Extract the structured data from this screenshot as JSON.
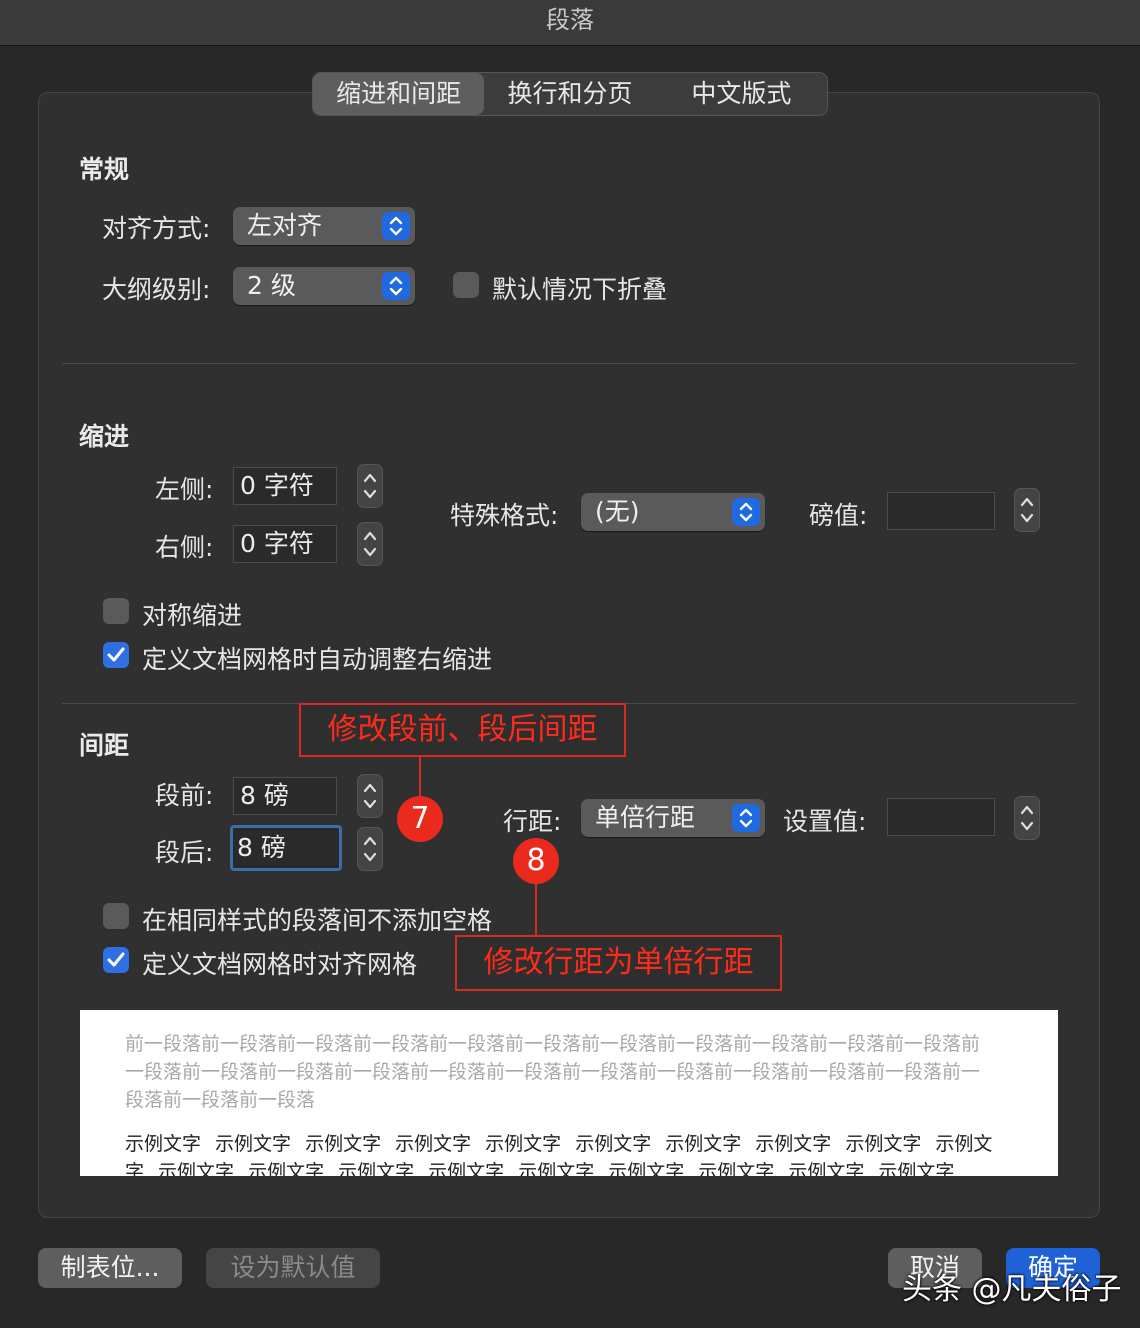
{
  "window": {
    "title": "段落"
  },
  "tabs": [
    {
      "label": "缩进和间距",
      "active": true
    },
    {
      "label": "换行和分页",
      "active": false
    },
    {
      "label": "中文版式",
      "active": false
    }
  ],
  "general": {
    "title": "常规",
    "alignment_label": "对齐方式:",
    "alignment_value": "左对齐",
    "outline_label": "大纲级别:",
    "outline_value": "2 级",
    "collapse_label": "默认情况下折叠",
    "collapse_checked": false
  },
  "indent": {
    "title": "缩进",
    "left_label": "左侧:",
    "left_value": "0 字符",
    "right_label": "右侧:",
    "right_value": "0 字符",
    "special_label": "特殊格式:",
    "special_value": "(无)",
    "by_label": "磅值:",
    "by_value": "",
    "mirror_label": "对称缩进",
    "mirror_checked": false,
    "auto_right_label": "定义文档网格时自动调整右缩进",
    "auto_right_checked": true
  },
  "spacing": {
    "title": "间距",
    "before_label": "段前:",
    "before_value": "8 磅",
    "after_label": "段后:",
    "after_value": "8 磅",
    "line_label": "行距:",
    "line_value": "单倍行距",
    "at_label": "设置值:",
    "at_value": "",
    "no_space_label": "在相同样式的段落间不添加空格",
    "no_space_checked": false,
    "snap_grid_label": "定义文档网格时对齐网格",
    "snap_grid_checked": true
  },
  "annotations": {
    "box1": "修改段前、段后间距",
    "badge1": "7",
    "badge2": "8",
    "box2": "修改行距为单倍行距"
  },
  "preview": {
    "previous_text": "前一段落前一段落前一段落前一段落前一段落前一段落前一段落前一段落前一段落前一段落前一段落前一段落前一段落前一段落前一段落前一段落前一段落前一段落前一段落前一段落前一段落前一段落前一段落前一段落前一段落",
    "sample_text": "示例文字 示例文字 示例文字 示例文字 示例文字 示例文字 示例文字 示例文字 示例文字 示例文字 示例文字 示例文字 示例文字 示例文字 示例文字 示例文字 示例文字 示例文字 示例文字"
  },
  "buttons": {
    "tabs": "制表位...",
    "set_default": "设为默认值",
    "cancel": "取消",
    "ok": "确定"
  },
  "watermark": "头条 @凡夫俗子",
  "colors": {
    "accent": "#2f6fe4",
    "annotation": "#ea2a1c",
    "background": "#282828"
  }
}
